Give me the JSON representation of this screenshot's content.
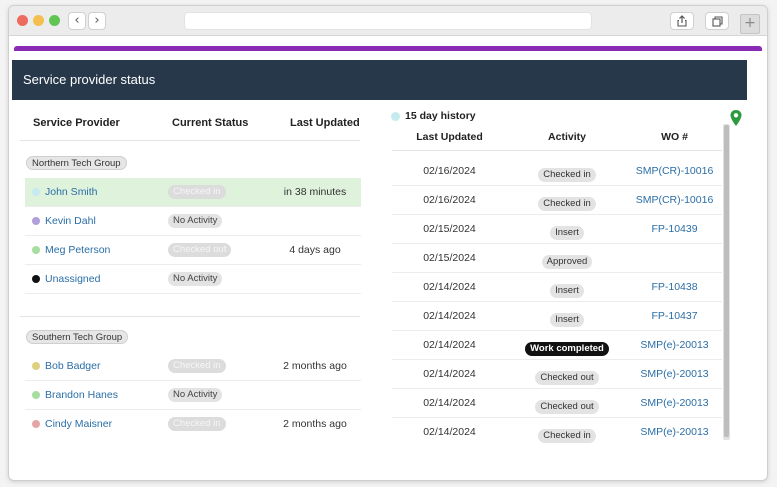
{
  "panel": {
    "title": "Service provider status"
  },
  "left": {
    "headers": {
      "provider": "Service Provider",
      "status": "Current Status",
      "updated": "Last Updated"
    },
    "groups": [
      {
        "name": "Northern Tech Group",
        "rows": [
          {
            "name": "John Smith",
            "color": "#c6ebee",
            "status": "Checked in",
            "faded": true,
            "updated": "in 38 minutes",
            "highlight": true
          },
          {
            "name": "Kevin Dahl",
            "color": "#b19fd9",
            "status": "No Activity",
            "faded": false,
            "updated": "",
            "highlight": false
          },
          {
            "name": "Meg Peterson",
            "color": "#a6dda0",
            "status": "Checked out",
            "faded": true,
            "updated": "4 days ago",
            "highlight": false
          },
          {
            "name": "Unassigned",
            "color": "#111111",
            "status": "No Activity",
            "faded": false,
            "updated": "",
            "highlight": false
          }
        ]
      },
      {
        "name": "Southern Tech Group",
        "rows": [
          {
            "name": "Bob Badger",
            "color": "#ddd180",
            "status": "Checked in",
            "faded": true,
            "updated": "2 months ago",
            "highlight": false
          },
          {
            "name": "Brandon Hanes",
            "color": "#a6dda0",
            "status": "No Activity",
            "faded": false,
            "updated": "",
            "highlight": false
          },
          {
            "name": "Cindy Maisner",
            "color": "#e3a6a6",
            "status": "Checked in",
            "faded": true,
            "updated": "2 months ago",
            "highlight": false
          }
        ]
      }
    ]
  },
  "right": {
    "title": "15 day history",
    "headers": {
      "updated": "Last Updated",
      "activity": "Activity",
      "wo": "WO #"
    },
    "rows": [
      {
        "date": "02/16/2024",
        "activity": "Checked in",
        "dark": false,
        "wo": "SMP(CR)-10016"
      },
      {
        "date": "02/16/2024",
        "activity": "Checked in",
        "dark": false,
        "wo": "SMP(CR)-10016"
      },
      {
        "date": "02/15/2024",
        "activity": "Insert",
        "dark": false,
        "wo": "FP-10439"
      },
      {
        "date": "02/15/2024",
        "activity": "Approved",
        "dark": false,
        "wo": ""
      },
      {
        "date": "02/14/2024",
        "activity": "Insert",
        "dark": false,
        "wo": "FP-10438"
      },
      {
        "date": "02/14/2024",
        "activity": "Insert",
        "dark": false,
        "wo": "FP-10437"
      },
      {
        "date": "02/14/2024",
        "activity": "Work completed",
        "dark": true,
        "wo": "SMP(e)-20013"
      },
      {
        "date": "02/14/2024",
        "activity": "Checked out",
        "dark": false,
        "wo": "SMP(e)-20013"
      },
      {
        "date": "02/14/2024",
        "activity": "Checked out",
        "dark": false,
        "wo": "SMP(e)-20013"
      },
      {
        "date": "02/14/2024",
        "activity": "Checked in",
        "dark": false,
        "wo": "SMP(e)-20013"
      }
    ]
  },
  "icons": {
    "back": "chevron-left-icon",
    "forward": "chevron-right-icon",
    "share": "share-icon",
    "tabs": "tabs-icon",
    "new_tab": "plus-icon",
    "map": "map-pin-icon"
  },
  "colors": {
    "accent": "#8a2bb6",
    "header_bg": "#26384a",
    "link": "#2a6ea6",
    "map_pin": "#2e9a3e"
  }
}
